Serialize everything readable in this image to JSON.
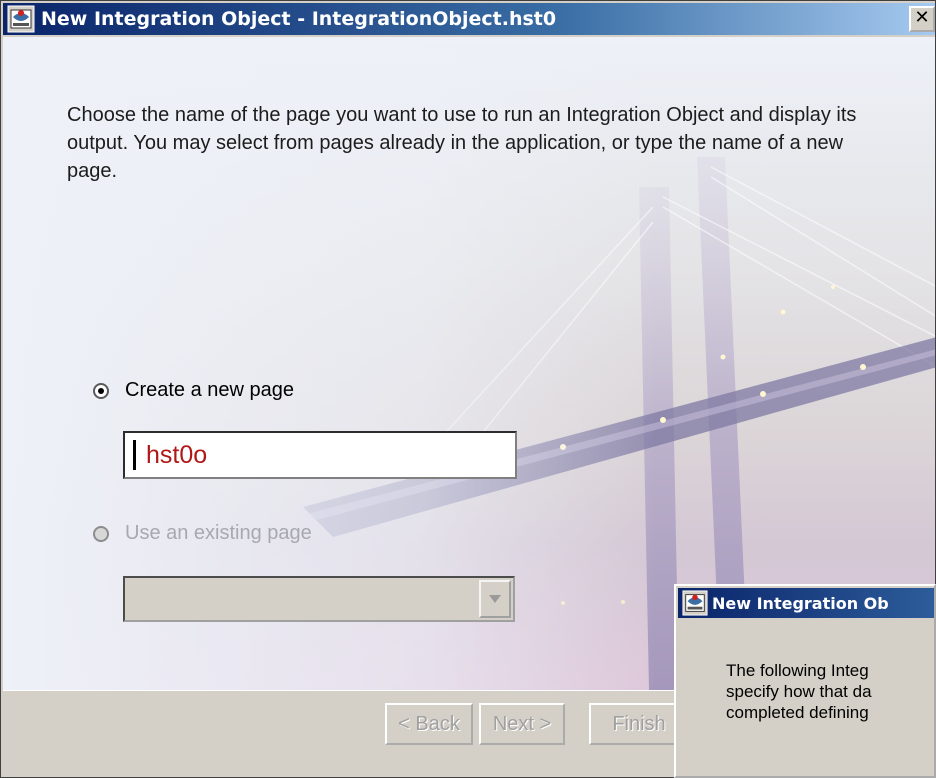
{
  "window": {
    "title": "New Integration Object - IntegrationObject.hst0",
    "close_label": "✕"
  },
  "instructions": "Choose the name of the page you want to use to run an Integration Object and display its output. You may select from pages already in the application, or type the name of a new page.",
  "options": {
    "create_new": {
      "label": "Create a new page",
      "selected": true
    },
    "use_existing": {
      "label": "Use an existing page",
      "selected": false,
      "enabled": false
    }
  },
  "page_name_input": {
    "value": "hst0o"
  },
  "existing_page_select": {
    "value": ""
  },
  "buttons": {
    "back": "< Back",
    "next": "Next >",
    "finish": "Finish"
  },
  "second_dialog": {
    "title": "New Integration Ob",
    "body_lines": [
      "The following Integ",
      "specify how that da",
      "completed defining"
    ]
  },
  "colors": {
    "title_bar": "#0a246a",
    "input_text": "#b01818",
    "disabled_text": "#a8a8b0"
  },
  "icons": [
    "app-icon",
    "close-icon",
    "chevron-down-icon"
  ]
}
